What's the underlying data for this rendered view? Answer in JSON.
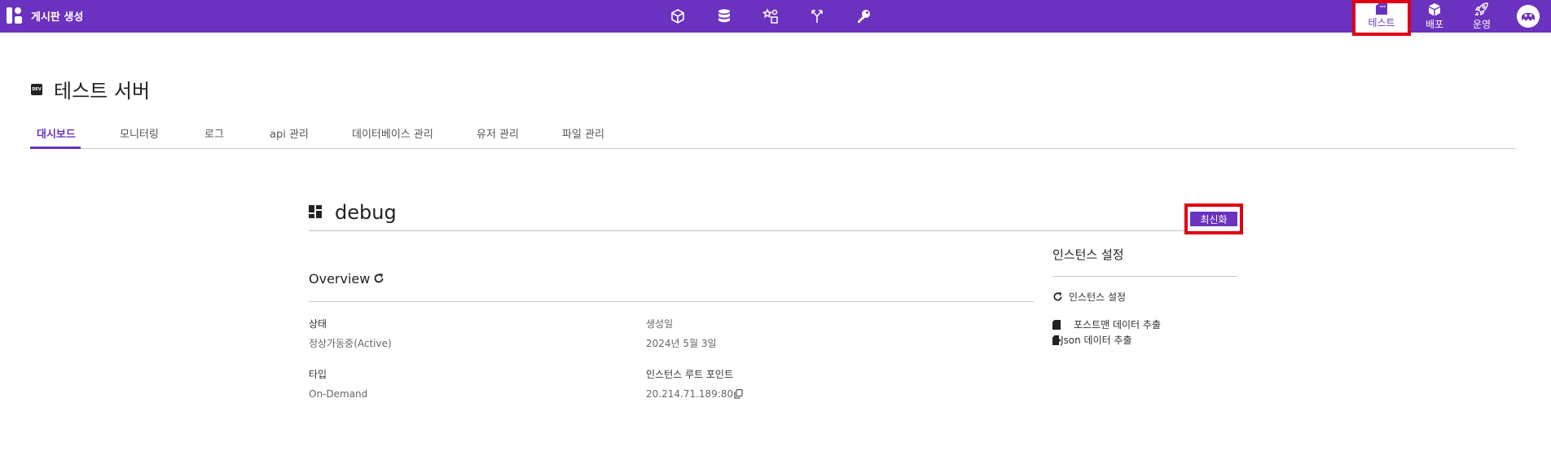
{
  "app": {
    "title": "게시판 생성"
  },
  "top_nav": {
    "center_icons": [
      "cube-outline-icon",
      "database-icon",
      "shapes-icon",
      "branch-arrows-icon",
      "key-icon"
    ],
    "items": [
      {
        "label": "테스트",
        "icon": "test-tag-icon",
        "active": true
      },
      {
        "label": "배포",
        "icon": "package-icon",
        "active": false
      },
      {
        "label": "운영",
        "icon": "rocket-icon",
        "active": false
      }
    ]
  },
  "page": {
    "badge": "DEV",
    "title": "테스트 서버"
  },
  "tabs": [
    {
      "label": "대시보드",
      "active": true
    },
    {
      "label": "모니터링",
      "active": false
    },
    {
      "label": "로그",
      "active": false
    },
    {
      "label": "api 관리",
      "active": false
    },
    {
      "label": "데이터베이스 관리",
      "active": false
    },
    {
      "label": "유저 관리",
      "active": false
    },
    {
      "label": "파일 관리",
      "active": false
    }
  ],
  "section": {
    "title": "debug",
    "refresh_label": "최신화"
  },
  "overview": {
    "title": "Overview",
    "fields": {
      "status_label": "상태",
      "status_value": "정상가동중(Active)",
      "created_label": "생성일",
      "created_value": "2024년 5월 3일",
      "type_label": "타입",
      "type_value": "On-Demand",
      "root_label": "인스턴스 루트 포인트",
      "root_value": "20.214.71.189:80"
    }
  },
  "instance_settings": {
    "title": "인스턴스 설정",
    "reset_label": "인스턴스 설정",
    "postman_label": "포스트맨 데이터 추출",
    "json_label": "Json 데이터 추출"
  },
  "colors": {
    "brand": "#6a32be",
    "highlight": "#e00012"
  }
}
